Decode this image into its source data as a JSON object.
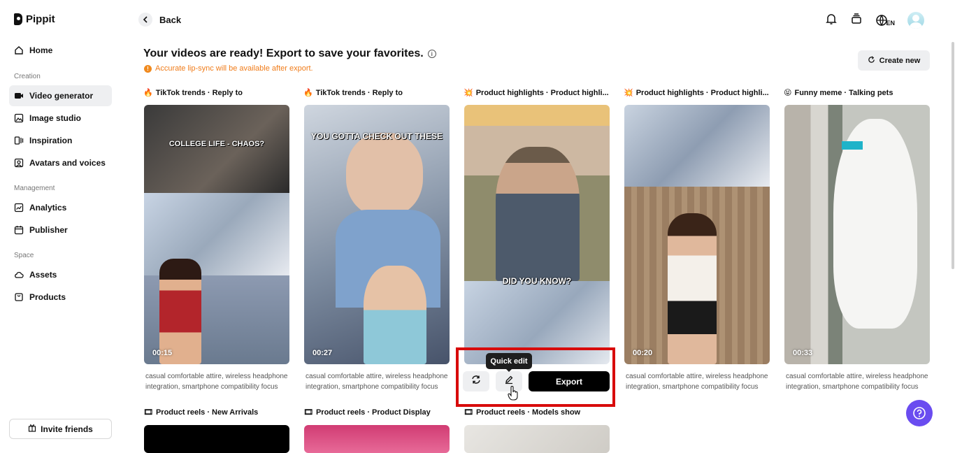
{
  "app": {
    "name": "Pippit"
  },
  "sidebar": {
    "items": [
      {
        "label": "Home",
        "icon": "home-icon"
      },
      {
        "section": "Creation"
      },
      {
        "label": "Video generator",
        "icon": "video-icon",
        "active": true
      },
      {
        "label": "Image studio",
        "icon": "image-icon"
      },
      {
        "label": "Inspiration",
        "icon": "inspiration-icon"
      },
      {
        "label": "Avatars and voices",
        "icon": "avatar-icon"
      },
      {
        "section": "Management"
      },
      {
        "label": "Analytics",
        "icon": "analytics-icon"
      },
      {
        "label": "Publisher",
        "icon": "calendar-icon"
      },
      {
        "section": "Space"
      },
      {
        "label": "Assets",
        "icon": "cloud-icon"
      },
      {
        "label": "Products",
        "icon": "bag-icon"
      }
    ],
    "sections": {
      "creation": "Creation",
      "management": "Management",
      "space": "Space"
    },
    "labels": {
      "home": "Home",
      "video_generator": "Video generator",
      "image_studio": "Image studio",
      "inspiration": "Inspiration",
      "avatars": "Avatars and voices",
      "analytics": "Analytics",
      "publisher": "Publisher",
      "assets": "Assets",
      "products": "Products"
    },
    "invite_label": "Invite friends"
  },
  "header": {
    "back_label": "Back",
    "language": "EN"
  },
  "main": {
    "title": "Your videos are ready! Export to save your favorites.",
    "notice": "Accurate lip-sync will be available after export.",
    "create_new_label": "Create new",
    "cards": [
      {
        "emoji": "🔥",
        "title": "TikTok trends · Reply to",
        "duration": "00:15",
        "caption": "casual comfortable attire, wireless headphone integration, smartphone compatibility focus",
        "overlay": "COLLEGE LIFE - CHAOS?"
      },
      {
        "emoji": "🔥",
        "title": "TikTok trends · Reply to",
        "duration": "00:27",
        "caption": "casual comfortable attire, wireless headphone integration, smartphone compatibility focus",
        "overlay": "YOU GOTTA CHECK OUT THESE"
      },
      {
        "emoji": "💥",
        "title": "Product highlights · Product highli...",
        "duration": "",
        "caption": "",
        "overlay": "DID YOU KNOW?"
      },
      {
        "emoji": "💥",
        "title": "Product highlights · Product highli...",
        "duration": "00:20",
        "caption": "casual comfortable attire, wireless headphone integration, smartphone compatibility focus",
        "overlay": ""
      },
      {
        "emoji": "😝",
        "title": "Funny meme · Talking pets",
        "duration": "00:33",
        "caption": "casual comfortable attire, wireless headphone integration, smartphone compatibility focus",
        "overlay": ""
      }
    ],
    "second_row": [
      {
        "emoji": "🎞",
        "title": "Product reels · New Arrivals"
      },
      {
        "emoji": "🎞",
        "title": "Product reels · Product Display"
      },
      {
        "emoji": "🎞",
        "title": "Product reels · Models show"
      }
    ],
    "hover_actions": {
      "tooltip": "Quick edit",
      "export_label": "Export"
    }
  },
  "colors": {
    "accent": "#6a4cf0",
    "warning": "#f07c1a",
    "highlight_box": "#d80b0b"
  }
}
